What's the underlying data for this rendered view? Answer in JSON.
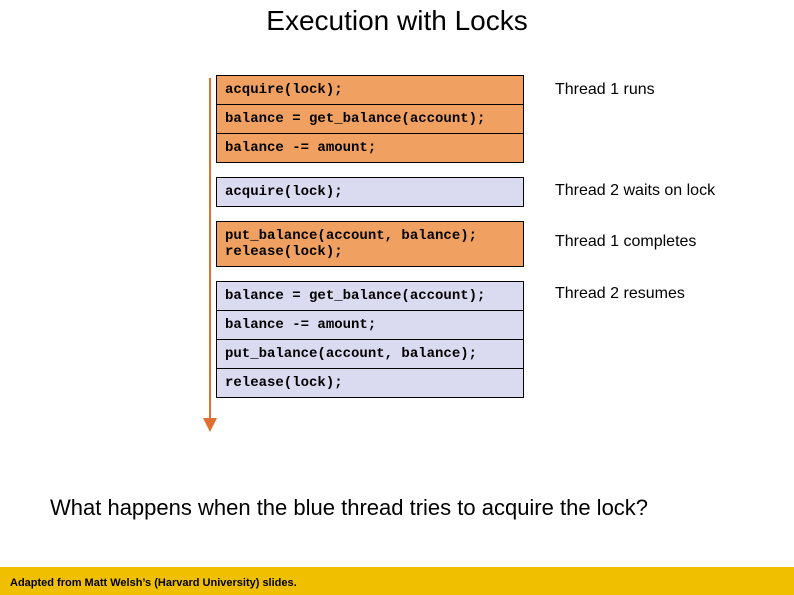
{
  "title": "Execution with Locks",
  "rows": [
    {
      "text": "acquire(lock);",
      "cls": "orange",
      "label": "Thread 1 runs",
      "stack": "top"
    },
    {
      "text": "balance = get_balance(account);",
      "cls": "orange",
      "label": "",
      "stack": "mid"
    },
    {
      "text": "balance -= amount;",
      "cls": "orange",
      "label": "",
      "stack": "bottom"
    },
    {
      "gap": true
    },
    {
      "text": "acquire(lock);",
      "cls": "blue",
      "label": "Thread 2 waits on lock",
      "stack": "single"
    },
    {
      "gap": true
    },
    {
      "text": "put_balance(account, balance);\nrelease(lock);",
      "cls": "orange",
      "label": "Thread 1 completes",
      "stack": "single",
      "tall": true
    },
    {
      "gap": true
    },
    {
      "text": "balance = get_balance(account);",
      "cls": "blue",
      "label": "Thread 2 resumes",
      "stack": "top"
    },
    {
      "text": "balance -= amount;",
      "cls": "blue",
      "label": "",
      "stack": "mid"
    },
    {
      "text": "put_balance(account, balance);",
      "cls": "blue",
      "label": "",
      "stack": "mid"
    },
    {
      "text": "release(lock);",
      "cls": "blue",
      "label": "",
      "stack": "bottom"
    }
  ],
  "question": "What happens when the blue thread tries to acquire the lock?",
  "footer": "Adapted from Matt Welsh’s (Harvard University) slides."
}
